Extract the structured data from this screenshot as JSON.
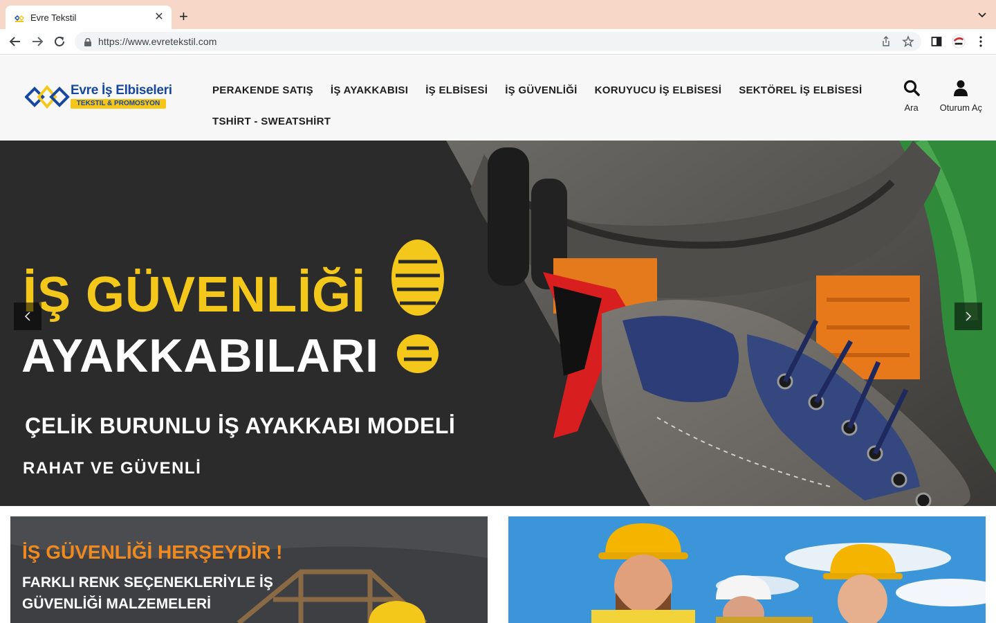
{
  "browser": {
    "tab_title": "Evre Tekstil",
    "url": "https://www.evretekstil.com"
  },
  "site": {
    "logo_title": "Evre İş Elbiseleri",
    "logo_subtitle": "TEKSTIL & PROMOSYON",
    "nav": [
      "PERAKENDE SATIŞ",
      "İŞ AYAKKABISI",
      "İŞ ELBİSESİ",
      "İŞ GÜVENLİĞİ",
      "KORUYUCU İŞ ELBİSESİ",
      "SEKTÖREL İŞ ELBİSESİ",
      "TSHİRT - SWEATSHİRT"
    ],
    "search_label": "Ara",
    "login_label": "Oturum Aç"
  },
  "hero": {
    "line1": "İŞ GÜVENLİĞİ",
    "line2": "AYAKKABILARI",
    "line3": "ÇELİK BURUNLU İŞ AYAKKABI MODELİ",
    "line4": "RAHAT VE GÜVENLİ"
  },
  "promo_left": {
    "title": "İŞ GÜVENLİĞİ HERŞEYDİR !",
    "subtitle": "FARKLI RENK SEÇENEKLERİYLE İŞ GÜVENLİĞİ MALZEMELERİ"
  },
  "colors": {
    "accent_yellow": "#f4c81b",
    "brand_blue": "#17479e",
    "promo_orange": "#f08a1f",
    "tab_strip": "#f7d8c8"
  }
}
